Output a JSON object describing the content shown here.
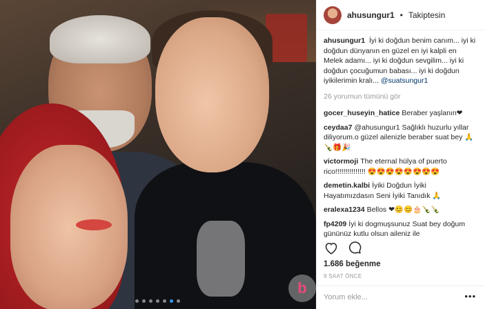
{
  "post": {
    "username": "ahusungur1",
    "separator": "•",
    "follow_status": "Takiptesin"
  },
  "caption": {
    "username": "ahusungur1",
    "text": "İyi ki doğdun benim canım... iyi ki doğdun dünyanın en güzel en iyi kalpli en Melek adamı... iyi ki doğdun sevgilim... iyi ki doğdun çocuğumun babası... iyi ki doğdun iyikilerimin kralı...",
    "mention": "@suatsungur1"
  },
  "view_all_comments": "26 yorumun tümünü gör",
  "comments": [
    {
      "username": "gocer_huseyin_hatice",
      "text": "Beraber yaşlanın❤"
    },
    {
      "username": "ceydaa7",
      "text": "@ahusungur1 Sağlıklı huzurlu yıllar diliyorum.o güzel ailenizle beraber suat bey 🙏🍾🎁🎉"
    },
    {
      "username": "victormoji",
      "text": "The eternal hülya of puerto rico!!!!!!!!!!!!!!! 😍😍😍😍😍😍😍😍"
    },
    {
      "username": "demetin.kalbi",
      "text": "İyiki Doğdun İyiki Hayatımızdasın Seni İyiki Tanıdık 🙏"
    },
    {
      "username": "eralexa1234",
      "text": "Bellos ❤😊😊🎂🍾🍾"
    },
    {
      "username": "fp4209",
      "text": "İyi ki dogmuşsunuz Suat bey doğum gününüz kutlu olsun aileniz ile"
    }
  ],
  "actions": {
    "like_icon": "heart-icon",
    "comment_icon": "comment-bubble-icon"
  },
  "likes_text": "1.686 beğenme",
  "timestamp": "9 SAAT ÖNCE",
  "add_comment": {
    "placeholder": "Yorum ekle..."
  },
  "more_options": "•••",
  "watermark": "b",
  "carousel": {
    "count": 7,
    "active_index": 5
  },
  "colors": {
    "link_blue": "#003569",
    "muted_gray": "#999999",
    "active_dot": "#3897f0"
  }
}
